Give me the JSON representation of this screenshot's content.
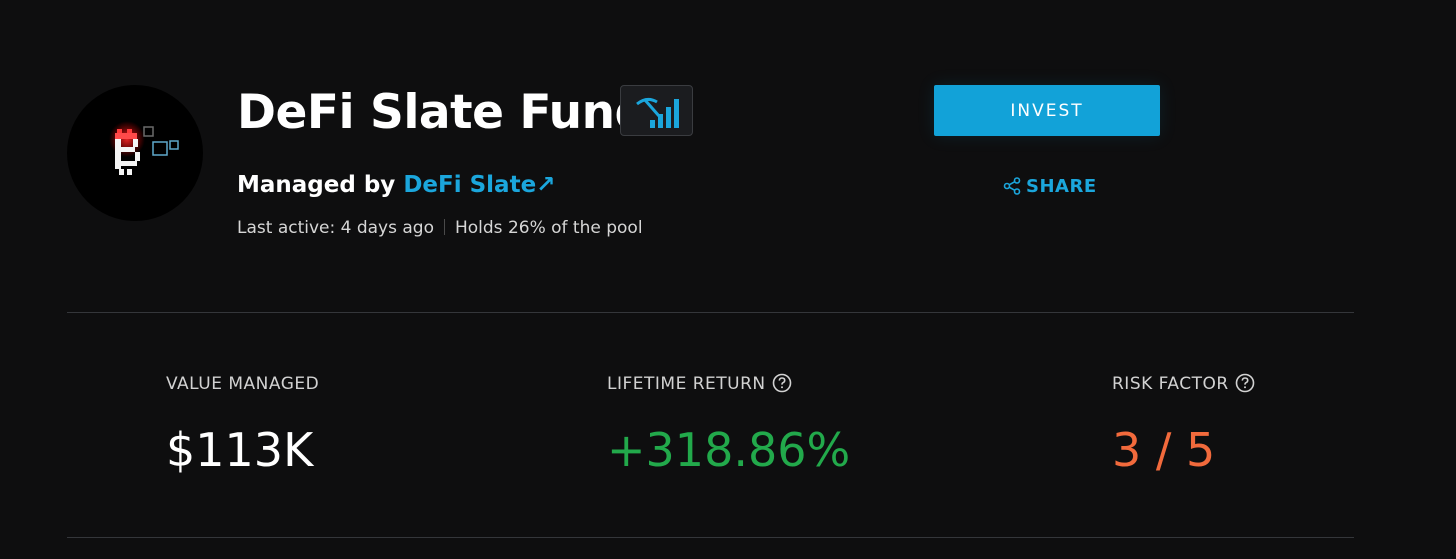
{
  "fund": {
    "name": "DeFi Slate Fund",
    "badge_icon": "pickaxe-chart-icon",
    "managed_prefix": "Managed by ",
    "manager_name": "DeFi Slate",
    "manager_link_arrow": "↗",
    "last_active": "Last active: 4 days ago",
    "pool_share": "Holds 26% of the pool"
  },
  "actions": {
    "invest_label": "INVEST",
    "share_label": "SHARE"
  },
  "stats": {
    "value_managed": {
      "label": "VALUE MANAGED",
      "value": "$113K"
    },
    "lifetime_return": {
      "label": "LIFETIME RETURN",
      "value": "+318.86%"
    },
    "risk_factor": {
      "label": "RISK FACTOR",
      "value": "3 / 5"
    }
  },
  "colors": {
    "background": "#0e0e0f",
    "accent": "#1ba6dc",
    "invest_button": "#12a2d8",
    "positive": "#22a94b",
    "risk": "#f26a3c"
  }
}
